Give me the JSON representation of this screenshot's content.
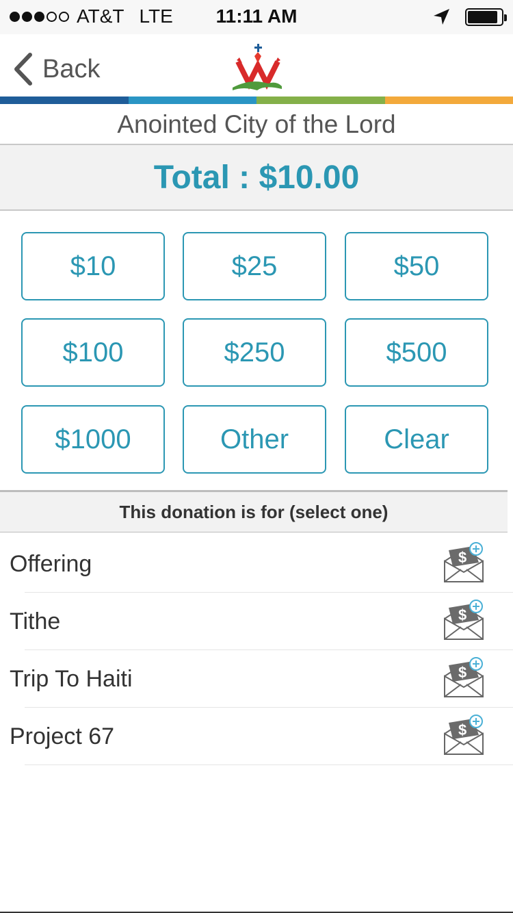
{
  "status_bar": {
    "carrier": "AT&T",
    "network": "LTE",
    "time": "11:11 AM",
    "signal_strength": 3,
    "signal_max": 5,
    "battery_level": 0.9
  },
  "nav": {
    "back_label": "Back",
    "logo_icon": "church-crown-logo-icon"
  },
  "brand_colors": [
    "#1f5d99",
    "#2a95c4",
    "#84b049",
    "#f3a93b"
  ],
  "accent_color": "#2b97b3",
  "church_name": "Anointed City of the Lord",
  "total": {
    "text": "Total : $10.00"
  },
  "amount_buttons": [
    {
      "label": "$10"
    },
    {
      "label": "$25"
    },
    {
      "label": "$50"
    },
    {
      "label": "$100"
    },
    {
      "label": "$250"
    },
    {
      "label": "$500"
    },
    {
      "label": "$1000"
    },
    {
      "label": "Other"
    },
    {
      "label": "Clear"
    }
  ],
  "donation_section": {
    "header": "This donation is for (select one)",
    "funds": [
      {
        "label": "Offering",
        "icon": "donation-envelope-plus-icon"
      },
      {
        "label": "Tithe",
        "icon": "donation-envelope-plus-icon"
      },
      {
        "label": "Trip To Haiti",
        "icon": "donation-envelope-plus-icon"
      },
      {
        "label": "Project 67",
        "icon": "donation-envelope-plus-icon"
      }
    ]
  }
}
